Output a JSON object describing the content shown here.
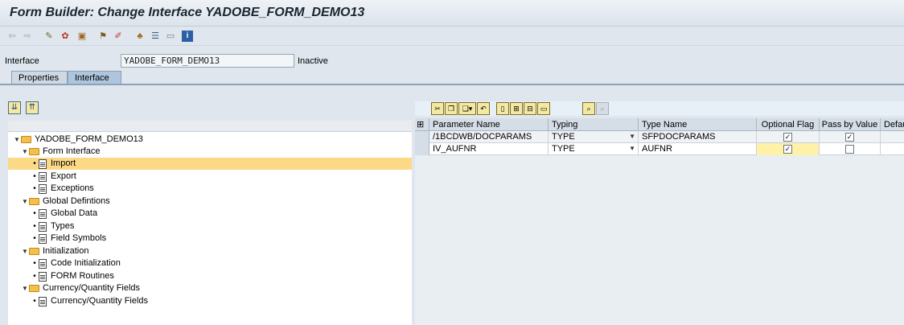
{
  "window": {
    "title": "Form Builder: Change Interface YADOBE_FORM_DEMO13"
  },
  "toolbar": {
    "icons": [
      "back-arrow-icon",
      "forward-arrow-icon",
      "display-change-icon",
      "activate-icon",
      "check-icon",
      "other-object-icon",
      "pattern-icon",
      "hierarchy-icon",
      "layout-icon",
      "window-icon",
      "info-icon"
    ]
  },
  "interface": {
    "label": "Interface",
    "value": "YADOBE_FORM_DEMO13",
    "status": "Inactive"
  },
  "tabs": [
    {
      "label": "Properties",
      "active": false
    },
    {
      "label": "Interface",
      "active": true
    }
  ],
  "tree": {
    "root": "YADOBE_FORM_DEMO13",
    "groups": [
      {
        "label": "Form Interface",
        "items": [
          "Import",
          "Export",
          "Exceptions"
        ]
      },
      {
        "label": "Global Defintions",
        "items": [
          "Global Data",
          "Types",
          "Field Symbols"
        ]
      },
      {
        "label": "Initialization",
        "items": [
          "Code Initialization",
          "FORM Routines"
        ]
      },
      {
        "label": "Currency/Quantity Fields",
        "items": [
          "Currency/Quantity Fields"
        ]
      }
    ],
    "selected": "Import"
  },
  "grid": {
    "columns": [
      "Parameter Name",
      "Typing",
      "Type Name",
      "Optional Flag",
      "Pass by Value",
      "Defau"
    ],
    "rows": [
      {
        "parameter": "/1BCDWB/DOCPARAMS",
        "typing": "TYPE",
        "type_name": "SFPDOCPARAMS",
        "optional": true,
        "pass_by_value": true
      },
      {
        "parameter": "IV_AUFNR",
        "typing": "TYPE",
        "type_name": "AUFNR",
        "optional": true,
        "pass_by_value": false
      }
    ]
  },
  "colors": {
    "selection": "#fcd986",
    "tab_active": "#aec6dd",
    "folder": "#f5c04a"
  }
}
